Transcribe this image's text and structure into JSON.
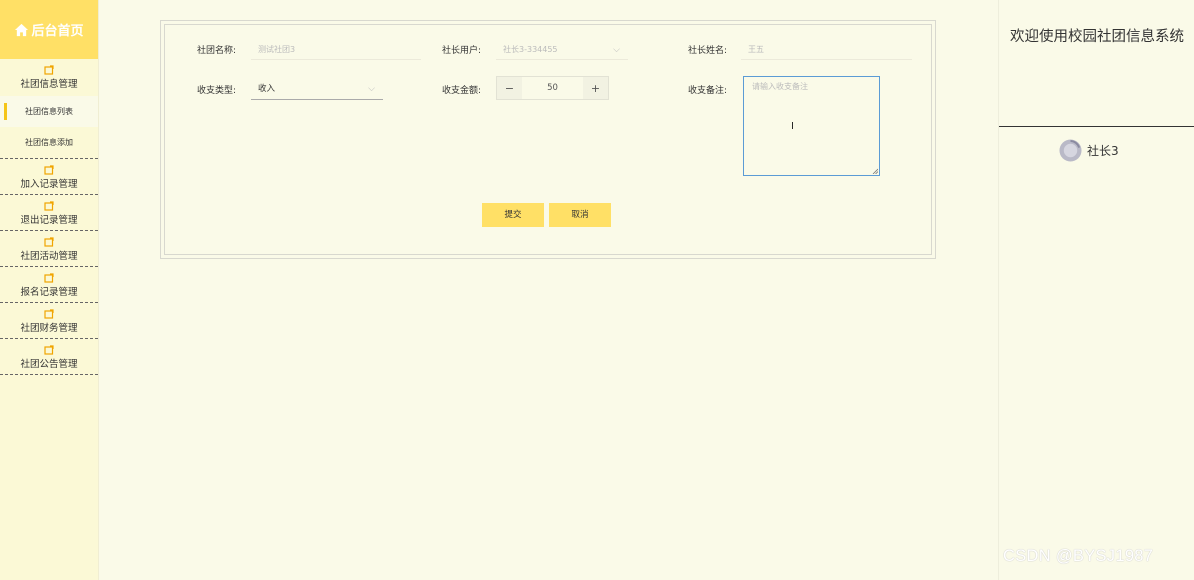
{
  "sidebar": {
    "title": "后台首页",
    "title_icon": "home-icon",
    "groups": [
      {
        "label": "社团信息管理",
        "icon": "folder-icon",
        "items": [
          {
            "label": "社团信息列表",
            "active": true
          },
          {
            "label": "社团信息添加",
            "active": false
          }
        ]
      },
      {
        "label": "加入记录管理",
        "icon": "folder-icon"
      },
      {
        "label": "退出记录管理",
        "icon": "folder-icon"
      },
      {
        "label": "社团活动管理",
        "icon": "folder-icon"
      },
      {
        "label": "报名记录管理",
        "icon": "folder-icon"
      },
      {
        "label": "社团财务管理",
        "icon": "folder-icon"
      },
      {
        "label": "社团公告管理",
        "icon": "folder-icon"
      }
    ]
  },
  "form": {
    "club_name": {
      "label": "社团名称:",
      "value": "测试社团3"
    },
    "president_user": {
      "label": "社长用户:",
      "value": "社长3-334455"
    },
    "president_name": {
      "label": "社长姓名:",
      "value": "王五"
    },
    "type": {
      "label": "收支类型:",
      "value": "收入"
    },
    "amount": {
      "label": "收支金额:",
      "value": "50",
      "minus": "−",
      "plus": "+"
    },
    "remark": {
      "label": "收支备注:",
      "placeholder": "请输入收支备注"
    },
    "submit_label": "提交",
    "cancel_label": "取消"
  },
  "header": {
    "welcome": "欢迎使用校园社团信息系统",
    "username": "社长3"
  },
  "watermark": "CSDN @BYSJ1987",
  "colors": {
    "accent": "#ffe066",
    "sidebar_bg": "#fbf9d6",
    "page_bg": "#fafae8",
    "focus_border": "#5b9bd5"
  }
}
